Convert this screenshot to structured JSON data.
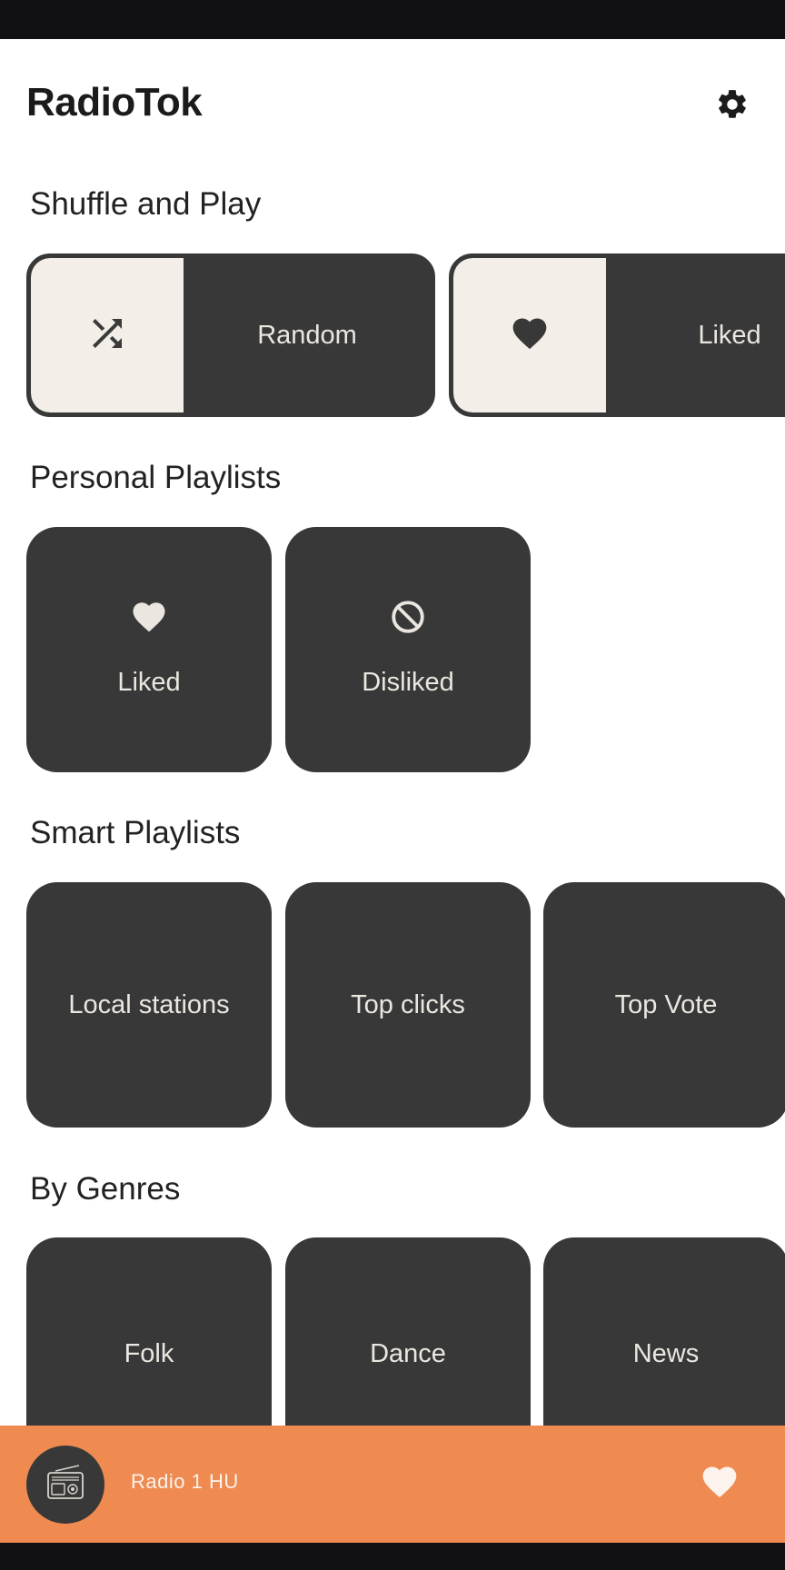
{
  "app": {
    "title": "RadioTok"
  },
  "icons": {
    "settings": "gear-icon",
    "shuffle": "shuffle-icon",
    "heart": "heart-icon",
    "block": "block-icon",
    "radio": "radio-icon"
  },
  "colors": {
    "card": "#383838",
    "thumb": "#f3efe8",
    "card_text": "#ebe7e0",
    "player": "#ef8b51"
  },
  "sections": {
    "shuffle": {
      "title": "Shuffle and Play",
      "items": [
        {
          "label": "Random",
          "icon": "shuffle-icon"
        },
        {
          "label": "Liked",
          "icon": "heart-icon"
        }
      ]
    },
    "personal": {
      "title": "Personal Playlists",
      "items": [
        {
          "label": "Liked",
          "icon": "heart-icon"
        },
        {
          "label": "Disliked",
          "icon": "block-icon"
        }
      ]
    },
    "smart": {
      "title": "Smart Playlists",
      "items": [
        {
          "label": "Local stations"
        },
        {
          "label": "Top clicks"
        },
        {
          "label": "Top Vote"
        }
      ]
    },
    "genres": {
      "title": "By Genres",
      "items": [
        {
          "label": "Folk"
        },
        {
          "label": "Dance"
        },
        {
          "label": "News"
        }
      ]
    }
  },
  "player": {
    "station": "Radio 1 HU",
    "liked": true
  }
}
